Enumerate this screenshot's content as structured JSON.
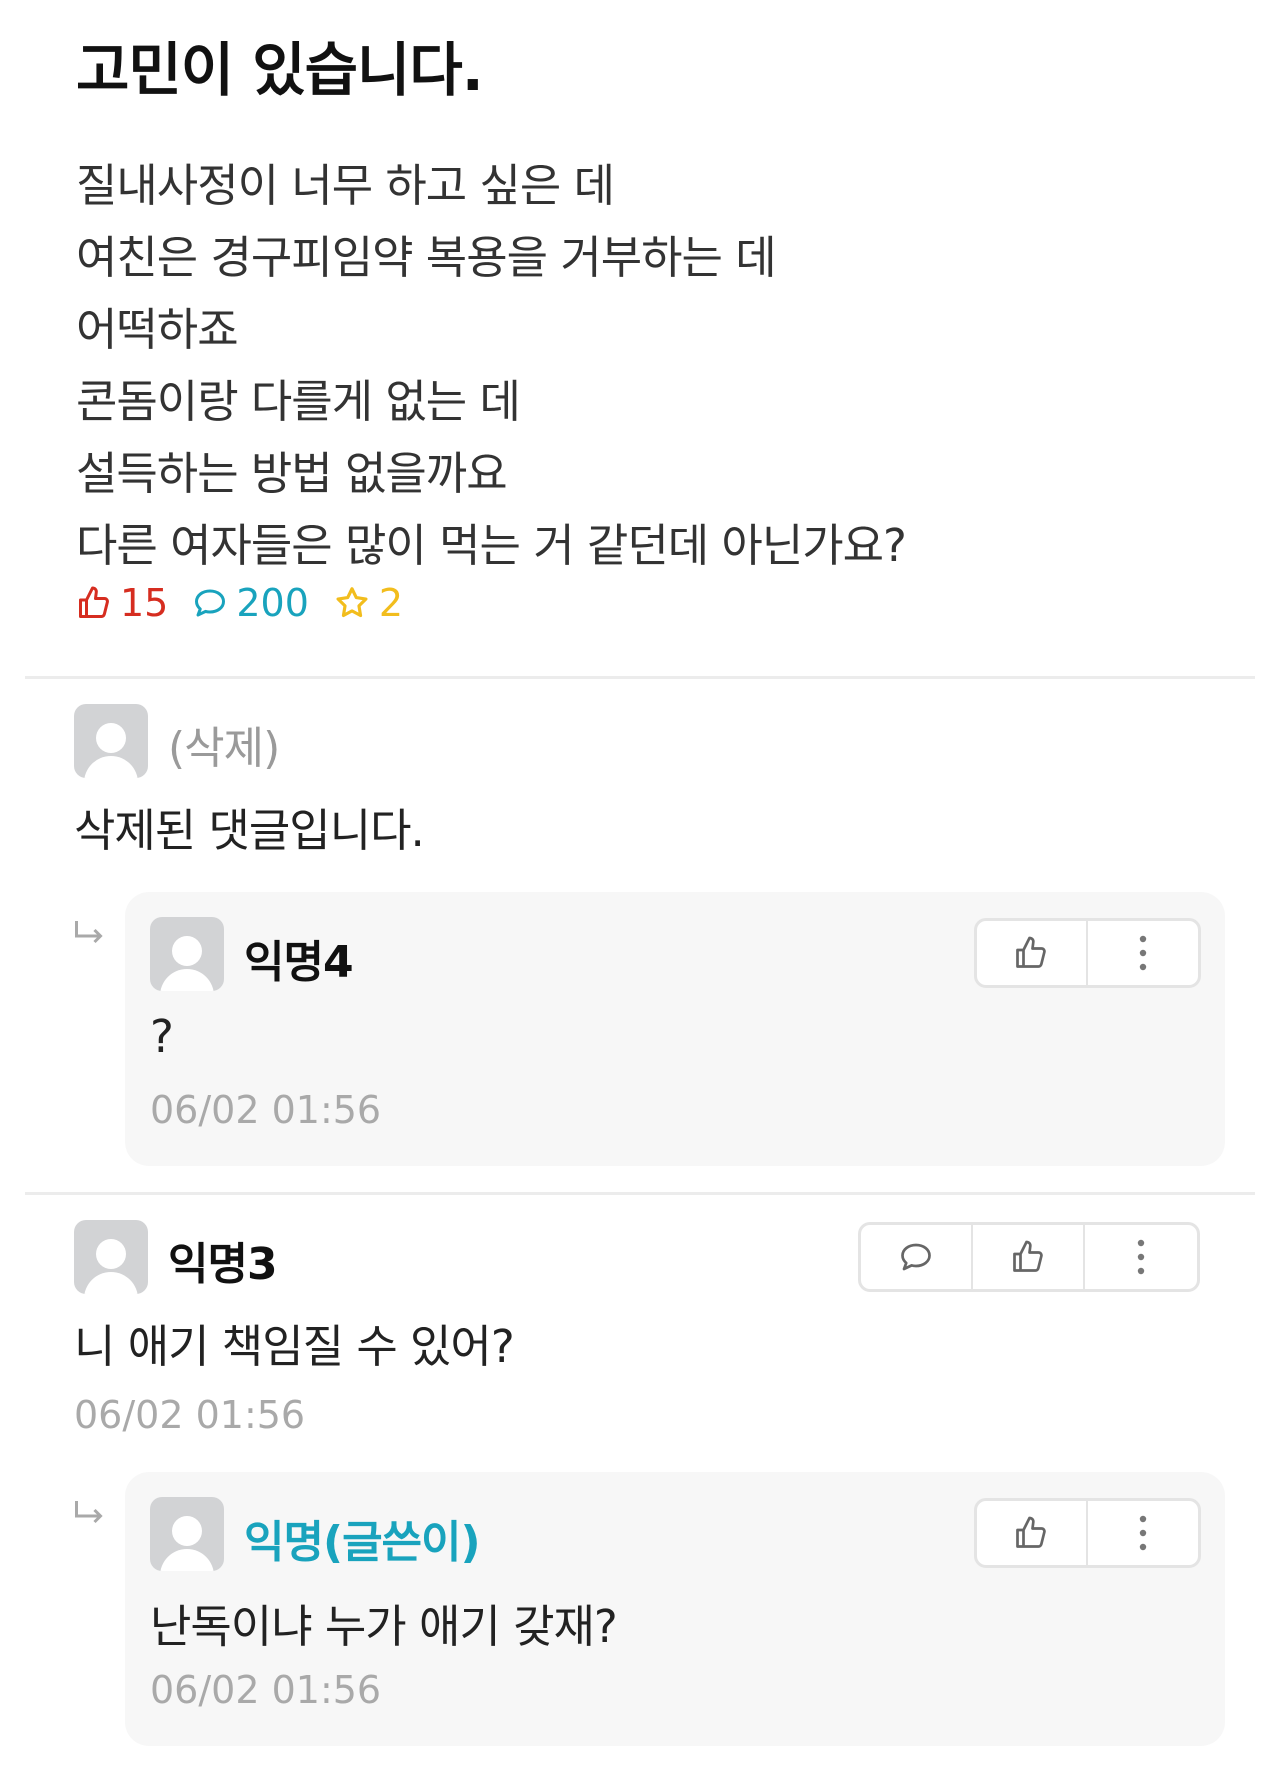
{
  "post": {
    "title": "고민이 있습니다.",
    "body_lines": [
      "질내사정이 너무 하고 싶은 데",
      "여친은 경구피임약 복용을 거부하는 데",
      "어떡하죠",
      "콘돔이랑 다를게 없는 데",
      "설득하는 방법 없을까요",
      "다른 여자들은 많이 먹는 거 같던데 아닌가요?"
    ],
    "stats": {
      "likes": "15",
      "comments": "200",
      "scraps": "2"
    }
  },
  "comments": [
    {
      "author": "(삭제)",
      "text": "삭제된 댓글입니다.",
      "replies": [
        {
          "author": "익명4",
          "text": "?",
          "time": "06/02 01:56"
        }
      ]
    },
    {
      "author": "익명3",
      "text": "니 애기 책임질 수 있어?",
      "time": "06/02 01:56",
      "replies": [
        {
          "author": "익명(글쓴이)",
          "text": "난독이냐 누가 애기 갖재?",
          "time": "06/02 01:56"
        }
      ]
    }
  ],
  "colors": {
    "like": "#d62d20",
    "comment": "#19a3bd",
    "scrap": "#f2bd1d",
    "op_author": "#19a3bd",
    "timestamp": "#a9a9a9"
  },
  "icons": {
    "like": "thumbs-up-icon",
    "comment": "speech-bubble-icon",
    "scrap": "star-icon",
    "more": "more-vertical-icon",
    "reply": "reply-arrow-icon"
  }
}
